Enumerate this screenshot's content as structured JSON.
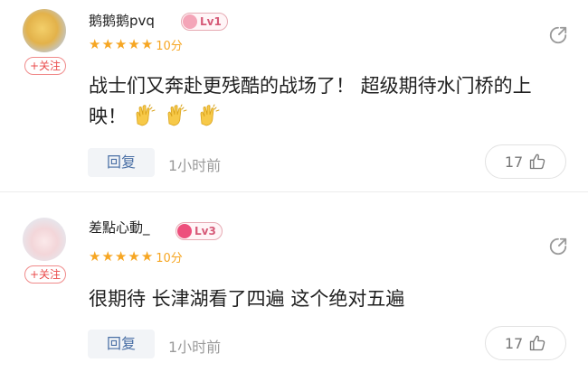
{
  "comments": [
    {
      "username": "鹅鹅鹅pvq",
      "level": "Lv1",
      "follow_label": "+关注",
      "stars": 5,
      "score": "10分",
      "content": "战士们又奔赴更残酷的战场了！ 超级期待水门桥的上映！",
      "emoji_count": 3,
      "emoji_icon": "clapping-hands-icon",
      "reply_label": "回复",
      "time": "1小时前",
      "likes": "17"
    },
    {
      "username": "差點心動_",
      "level": "Lv3",
      "follow_label": "+关注",
      "stars": 5,
      "score": "10分",
      "content": "很期待 长津湖看了四遍 这个绝对五遍",
      "reply_label": "回复",
      "time": "1小时前",
      "likes": "17"
    }
  ],
  "colors": {
    "star": "#f6a623",
    "follow": "#ea4c4c",
    "reply_text": "#4a6fa5",
    "level_badge": "#d65a78"
  }
}
